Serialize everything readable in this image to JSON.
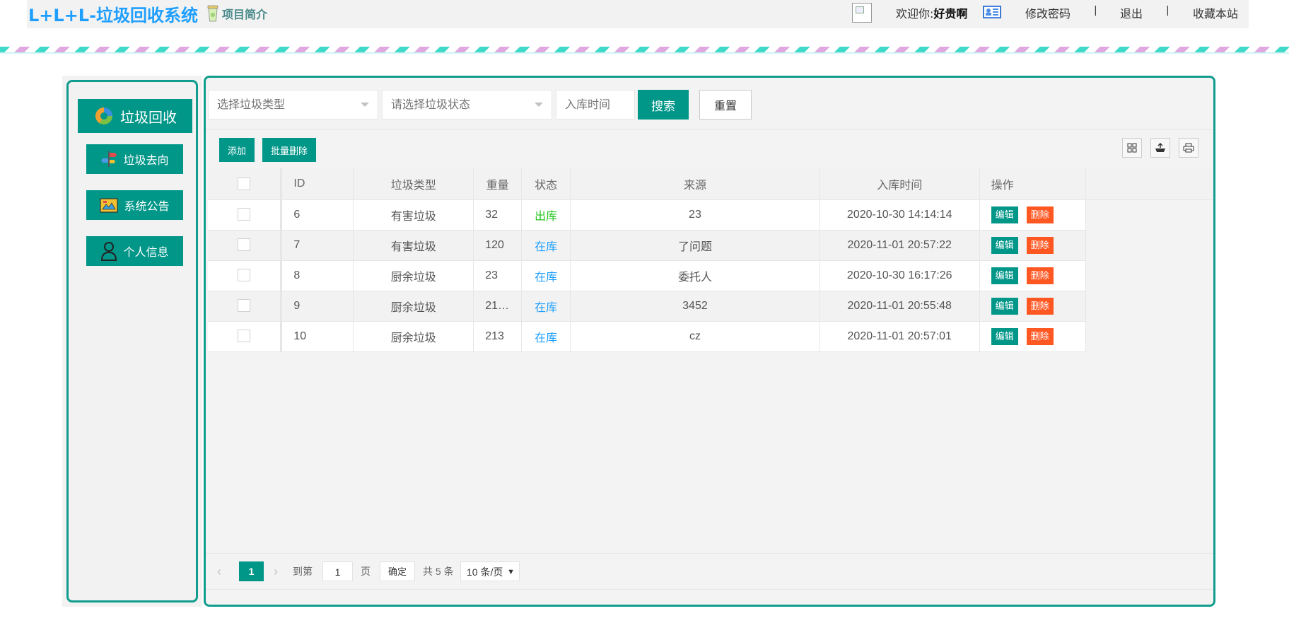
{
  "header": {
    "app_title": "L+L+L-垃圾回收系统",
    "intro_label": "项目简介",
    "welcome_prefix": "欢迎你:",
    "username": "好贵啊",
    "links": {
      "change_password": "修改密码",
      "logout": "退出",
      "bookmark": "收藏本站"
    },
    "separator": "|"
  },
  "sidebar": {
    "main_label": "垃圾回收",
    "items": [
      {
        "label": "垃圾去向",
        "icon": "signpost-icon"
      },
      {
        "label": "系统公告",
        "icon": "announcement-icon"
      },
      {
        "label": "个人信息",
        "icon": "user-icon"
      }
    ]
  },
  "filters": {
    "type_placeholder": "选择垃圾类型",
    "status_placeholder": "请选择垃圾状态",
    "time_placeholder": "入库时间",
    "search_label": "搜索",
    "reset_label": "重置"
  },
  "toolbar": {
    "add_label": "添加",
    "batch_delete_label": "批量删除",
    "icons": [
      "columns-icon",
      "export-icon",
      "print-icon"
    ]
  },
  "table": {
    "columns": [
      "ID",
      "垃圾类型",
      "重量",
      "状态",
      "来源",
      "入库时间",
      "操作"
    ],
    "rows": [
      {
        "id": "6",
        "type": "有害垃圾",
        "weight": "32",
        "status": "出库",
        "source": "23",
        "time": "2020-10-30 14:14:14"
      },
      {
        "id": "7",
        "type": "有害垃圾",
        "weight": "120",
        "status": "在库",
        "source": "了问题",
        "time": "2020-11-01 20:57:22"
      },
      {
        "id": "8",
        "type": "厨余垃圾",
        "weight": "23",
        "status": "在库",
        "source": "委托人",
        "time": "2020-10-30 16:17:26"
      },
      {
        "id": "9",
        "type": "厨余垃圾",
        "weight": "21…",
        "status": "在库",
        "source": "3452",
        "time": "2020-11-01 20:55:48"
      },
      {
        "id": "10",
        "type": "厨余垃圾",
        "weight": "213",
        "status": "在库",
        "source": "cz",
        "time": "2020-11-01 20:57:01"
      }
    ],
    "edit_label": "编辑",
    "delete_label": "删除"
  },
  "pagination": {
    "current_page": "1",
    "goto_label": "到第",
    "goto_value": "1",
    "page_unit": "页",
    "confirm_label": "确定",
    "total_text": "共 5 条",
    "page_size": "10 条/页"
  },
  "colors": {
    "accent": "#009688",
    "title": "#1e9fff",
    "danger": "#ff5722",
    "status_out": "#23c51d",
    "status_in": "#1e9fff"
  }
}
